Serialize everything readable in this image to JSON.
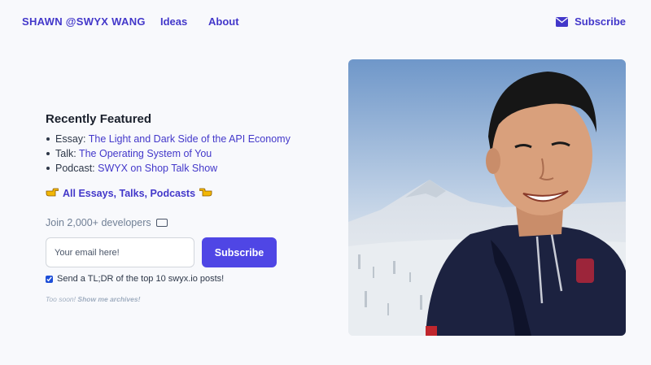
{
  "nav": {
    "brand": "SHAWN @SWYX WANG",
    "ideas": "Ideas",
    "about": "About",
    "subscribe": "Subscribe"
  },
  "featured": {
    "title": "Recently Featured",
    "items": [
      {
        "prefix": "Essay: ",
        "link": "The Light and Dark Side of the API Economy"
      },
      {
        "prefix": "Talk: ",
        "link": "The Operating System of You"
      },
      {
        "prefix": "Podcast: ",
        "link": "SWYX on Shop Talk Show"
      }
    ],
    "all_link": "All Essays, Talks, Podcasts"
  },
  "newsletter": {
    "join": "Join 2,000+ developers",
    "email_placeholder": "Your email here!",
    "button": "Subscribe",
    "checkbox_label": "Send a TL;DR of the top 10 swyx.io posts!",
    "too_soon": "Too soon!",
    "archives_link": "Show me archives!"
  },
  "icons": {
    "mail": "mail-icon",
    "hand_right": "pointing-right-hand-icon",
    "hand_left": "pointing-left-hand-icon",
    "keyboard": "keyboard-icon"
  },
  "colors": {
    "accent": "#4338ca",
    "button": "#4f46e5",
    "background": "#f8f9fc"
  }
}
